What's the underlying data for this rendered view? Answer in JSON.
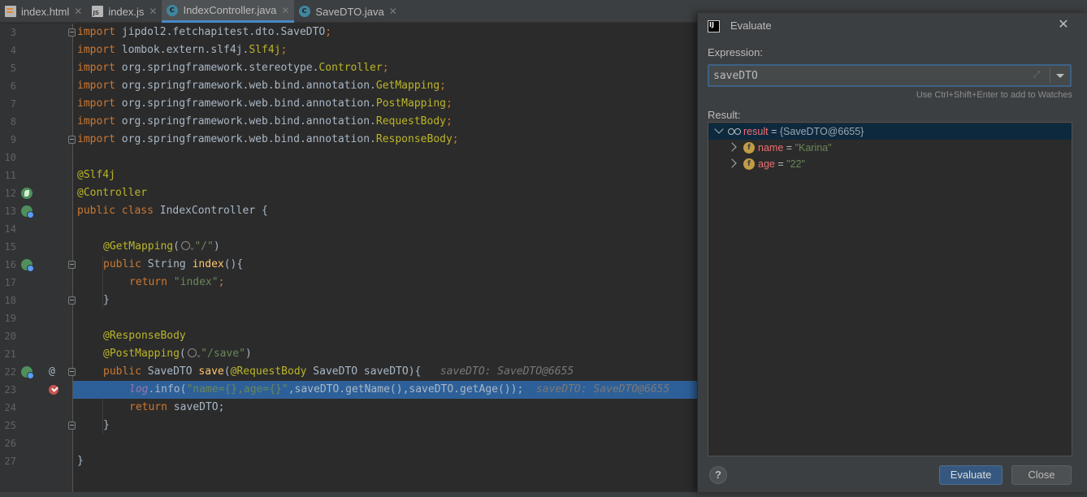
{
  "tabs": [
    {
      "label": "index.html",
      "icon": "html-file-icon"
    },
    {
      "label": "index.js",
      "icon": "js-file-icon"
    },
    {
      "label": "IndexController.java",
      "icon": "java-class-icon",
      "active": true
    },
    {
      "label": "SaveDTO.java",
      "icon": "java-class-icon"
    }
  ],
  "tab_close_glyph": "✕",
  "editor": {
    "lines": [
      {
        "num": "3"
      },
      {
        "num": "4"
      },
      {
        "num": "5"
      },
      {
        "num": "6"
      },
      {
        "num": "7"
      },
      {
        "num": "8"
      },
      {
        "num": "9"
      },
      {
        "num": "10"
      },
      {
        "num": "11"
      },
      {
        "num": "12"
      },
      {
        "num": "13"
      },
      {
        "num": "14"
      },
      {
        "num": "15"
      },
      {
        "num": "16"
      },
      {
        "num": "17"
      },
      {
        "num": "18"
      },
      {
        "num": "19"
      },
      {
        "num": "20"
      },
      {
        "num": "21"
      },
      {
        "num": "22"
      },
      {
        "num": "23"
      },
      {
        "num": "24"
      },
      {
        "num": "25"
      },
      {
        "num": "26"
      },
      {
        "num": "27"
      }
    ],
    "tokens": {
      "import_kw": "import",
      "l3_pkg": " jipdol2.fetchapitest.dto.",
      "l3_cls": "SaveDTO",
      "l4_pkg": " lombok.extern.slf4j.",
      "l4_cls": "Slf4j",
      "l5_pkg": " org.springframework.stereotype.",
      "l5_cls": "Controller",
      "l6_pkg": " org.springframework.web.bind.annotation.",
      "l6_cls": "GetMapping",
      "l7_pkg": " org.springframework.web.bind.annotation.",
      "l7_cls": "PostMapping",
      "l8_pkg": " org.springframework.web.bind.annotation.",
      "l8_cls": "RequestBody",
      "l9_pkg": " org.springframework.web.bind.annotation.",
      "l9_cls": "ResponseBody",
      "semi": ";",
      "l11": "@Slf4j",
      "l12": "@Controller",
      "l13_kw": "public class",
      "l13_rest": " IndexController {",
      "l15_an": "@GetMapping",
      "l15_open": "(",
      "l15_str": "\"/\"",
      "l15_close": ")",
      "l16_kw": "public",
      "l16_type": " String ",
      "l16_fn": "index",
      "l16_rest": "(){",
      "l17_kw": "return",
      "l17_str": " \"index\"",
      "l17_semi": ";",
      "l18": "}",
      "l20": "@ResponseBody",
      "l21_an": "@PostMapping",
      "l21_open": "(",
      "l21_str": "\"/save\"",
      "l21_close": ")",
      "l22_kw": "public",
      "l22_type": " SaveDTO ",
      "l22_fn": "save",
      "l22_open": "(",
      "l22_an": "@RequestBody",
      "l22_rest": " SaveDTO saveDTO){",
      "l22_hint": "saveDTO: SaveDTO@6655",
      "l23_fld": "log",
      "l23_dot": ".info(",
      "l23_str": "\"name={},age={}\"",
      "l23_rest": ",saveDTO.getName(),saveDTO.getAge());",
      "l23_hint": "saveDTO: SaveDTO@6655",
      "l24_kw": "return",
      "l24_rest": " saveDTO;",
      "l25": "}",
      "l27": "}",
      "at_glyph": "@",
      "chevron": "⌄"
    }
  },
  "dialog": {
    "title": "Evaluate",
    "close_glyph": "✕",
    "expression_label": "Expression:",
    "expression_value": "saveDTO",
    "expand_glyph": "⤢",
    "hint": "Use Ctrl+Shift+Enter to add to Watches",
    "result_label": "Result:",
    "result": {
      "name": "result",
      "eq": "=",
      "value": "{SaveDTO@6655}",
      "children": [
        {
          "name": "name",
          "eq": "=",
          "value": "\"Karina\"",
          "icon_letter": "f"
        },
        {
          "name": "age",
          "eq": "=",
          "value": "\"22\"",
          "icon_letter": "f"
        }
      ]
    },
    "help_glyph": "?",
    "evaluate_label": "Evaluate",
    "close_label": "Close"
  }
}
